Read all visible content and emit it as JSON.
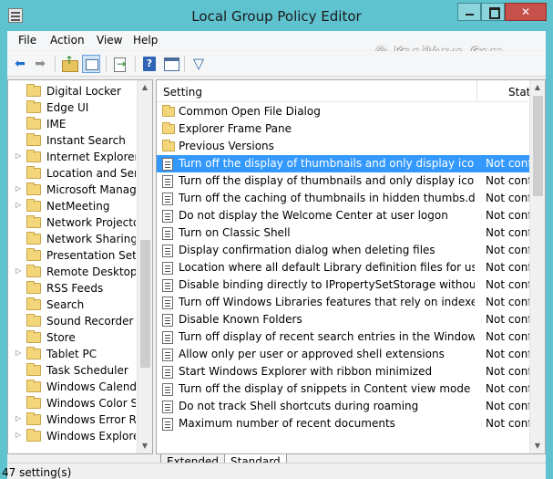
{
  "window": {
    "title": "Local Group Policy Editor",
    "close_glyph": "✕"
  },
  "menu": [
    "File",
    "Action",
    "View",
    "Help"
  ],
  "watermark": "© KapilArya.Com",
  "toolbar": {
    "back_glyph": "⬅",
    "forward_glyph": "➡",
    "filter_glyph": "▽"
  },
  "tree": {
    "items": [
      {
        "label": "Digital Locker",
        "expandable": false
      },
      {
        "label": "Edge UI",
        "expandable": false
      },
      {
        "label": "IME",
        "expandable": false
      },
      {
        "label": "Instant Search",
        "expandable": false
      },
      {
        "label": "Internet Explorer",
        "expandable": true
      },
      {
        "label": "Location and Sens",
        "expandable": false
      },
      {
        "label": "Microsoft Manage",
        "expandable": true
      },
      {
        "label": "NetMeeting",
        "expandable": true
      },
      {
        "label": "Network Projector",
        "expandable": false
      },
      {
        "label": "Network Sharing",
        "expandable": false
      },
      {
        "label": "Presentation Settir",
        "expandable": false
      },
      {
        "label": "Remote Desktop S",
        "expandable": true
      },
      {
        "label": "RSS Feeds",
        "expandable": false
      },
      {
        "label": "Search",
        "expandable": false
      },
      {
        "label": "Sound Recorder",
        "expandable": false
      },
      {
        "label": "Store",
        "expandable": false
      },
      {
        "label": "Tablet PC",
        "expandable": true
      },
      {
        "label": "Task Scheduler",
        "expandable": false
      },
      {
        "label": "Windows Calendar",
        "expandable": false
      },
      {
        "label": "Windows Color Sy",
        "expandable": false
      },
      {
        "label": "Windows Error Rep",
        "expandable": true
      },
      {
        "label": "Windows Explorer",
        "expandable": true
      }
    ]
  },
  "list": {
    "columns": {
      "setting": "Setting",
      "state": "Stat"
    },
    "rows": [
      {
        "type": "folder",
        "name": "Common Open File Dialog",
        "state": ""
      },
      {
        "type": "folder",
        "name": "Explorer Frame Pane",
        "state": ""
      },
      {
        "type": "folder",
        "name": "Previous Versions",
        "state": ""
      },
      {
        "type": "policy",
        "name": "Turn off the display of thumbnails and only display icons.",
        "state": "Not confi",
        "selected": true
      },
      {
        "type": "policy",
        "name": "Turn off the display of thumbnails and only display icons on...",
        "state": "Not confi"
      },
      {
        "type": "policy",
        "name": "Turn off the caching of thumbnails in hidden thumbs.db files",
        "state": "Not confi"
      },
      {
        "type": "policy",
        "name": "Do not display the Welcome Center at user logon",
        "state": "Not confi"
      },
      {
        "type": "policy",
        "name": "Turn on Classic Shell",
        "state": "Not confi"
      },
      {
        "type": "policy",
        "name": "Display confirmation dialog when deleting files",
        "state": "Not confi"
      },
      {
        "type": "policy",
        "name": "Location where all default Library definition files for users/m...",
        "state": "Not confi"
      },
      {
        "type": "policy",
        "name": "Disable binding directly to IPropertySetStorage without inter...",
        "state": "Not confi"
      },
      {
        "type": "policy",
        "name": "Turn off Windows Libraries features that rely on indexed file ...",
        "state": "Not confi"
      },
      {
        "type": "policy",
        "name": "Disable Known Folders",
        "state": "Not confi"
      },
      {
        "type": "policy",
        "name": "Turn off display of recent search entries in the Windows Explor",
        "state": "Not confi"
      },
      {
        "type": "policy",
        "name": "Allow only per user or approved shell extensions",
        "state": "Not confi"
      },
      {
        "type": "policy",
        "name": "Start Windows Explorer with ribbon minimized",
        "state": "Not confi"
      },
      {
        "type": "policy",
        "name": "Turn off the display of snippets in Content view mode",
        "state": "Not confi"
      },
      {
        "type": "policy",
        "name": "Do not track Shell shortcuts during roaming",
        "state": "Not confi"
      },
      {
        "type": "policy",
        "name": "Maximum number of recent documents",
        "state": "Not confi"
      }
    ]
  },
  "tabs": {
    "extended": "Extended",
    "standard": "Standard"
  },
  "status": "47 setting(s)"
}
